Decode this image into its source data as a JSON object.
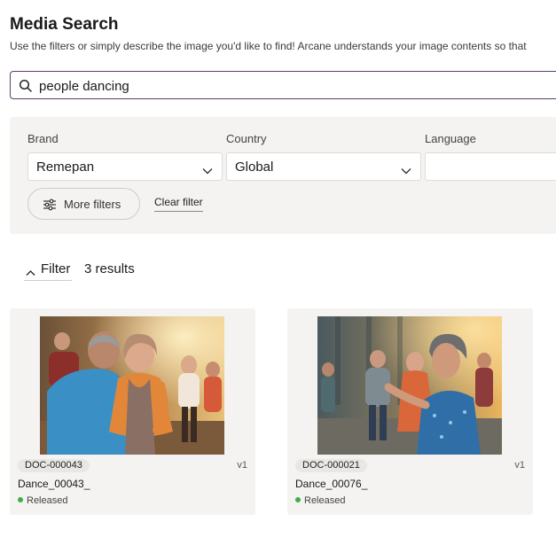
{
  "page": {
    "title": "Media Search",
    "subtitle": "Use the filters or simply describe the image you'd like to find! Arcane understands your image contents so that"
  },
  "search": {
    "value": "people dancing",
    "icon": "search-icon"
  },
  "filters": {
    "brand": {
      "label": "Brand",
      "value": "Remepan"
    },
    "country": {
      "label": "Country",
      "value": "Global"
    },
    "language": {
      "label": "Language",
      "value": ""
    },
    "more_filters_label": "More filters",
    "clear_filter_label": "Clear filter"
  },
  "results_bar": {
    "filter_label": "Filter",
    "count_text": "3 results"
  },
  "cards": [
    {
      "doc_id": "DOC-000043",
      "version": "v1",
      "name": "Dance_00043_",
      "status": "Released"
    },
    {
      "doc_id": "DOC-000021",
      "version": "v1",
      "name": "Dance_00076_",
      "status": "Released"
    }
  ],
  "colors": {
    "accent_border": "#5a3d6b",
    "panel_bg": "#f4f3f1",
    "status_released": "#3fae49"
  }
}
